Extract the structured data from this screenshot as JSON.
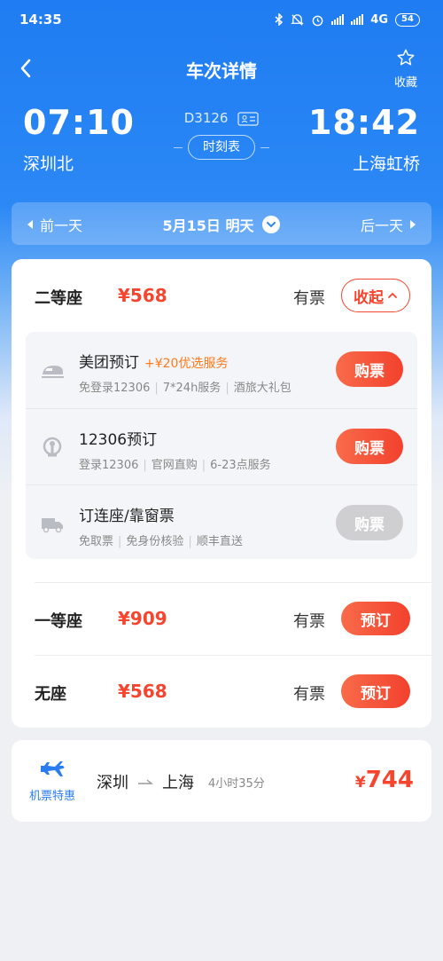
{
  "status_bar": {
    "time": "14:35",
    "network": "4G",
    "battery": "54"
  },
  "nav": {
    "title": "车次详情",
    "favorite_label": "收藏"
  },
  "train": {
    "number": "D3126",
    "departure_time": "07:10",
    "departure_station": "深圳北",
    "arrival_time": "18:42",
    "arrival_station": "上海虹桥",
    "timetable_label": "时刻表"
  },
  "date_bar": {
    "prev_label": "前一天",
    "current_date": "5月15日 明天",
    "next_label": "后一天"
  },
  "seats": {
    "second_class": {
      "name": "二等座",
      "price": "¥568",
      "availability": "有票",
      "collapse_label": "收起"
    },
    "options": [
      {
        "title": "美团预订",
        "promo": "+¥20优选服务",
        "desc": [
          "免登录12306",
          "7*24h服务",
          "酒旅大礼包"
        ],
        "button": "购票",
        "icon": "train-icon"
      },
      {
        "title": "12306预订",
        "promo": "",
        "desc": [
          "登录12306",
          "官网直购",
          "6-23点服务"
        ],
        "button": "购票",
        "icon": "railway-logo-icon"
      },
      {
        "title": "订连座/靠窗票",
        "promo": "",
        "desc": [
          "免取票",
          "免身份核验",
          "顺丰直送"
        ],
        "button": "购票",
        "icon": "truck-icon"
      }
    ],
    "first_class": {
      "name": "一等座",
      "price": "¥909",
      "availability": "有票",
      "button": "预订"
    },
    "no_seat": {
      "name": "无座",
      "price": "¥568",
      "availability": "有票",
      "button": "预订"
    }
  },
  "flight": {
    "label": "机票特惠",
    "from": "深圳",
    "to": "上海",
    "duration": "4小时35分",
    "currency": "¥",
    "price": "744"
  },
  "colors": {
    "primary_blue": "#1f7cf2",
    "price_red": "#f5452e",
    "promo_orange": "#ff7a1a"
  }
}
